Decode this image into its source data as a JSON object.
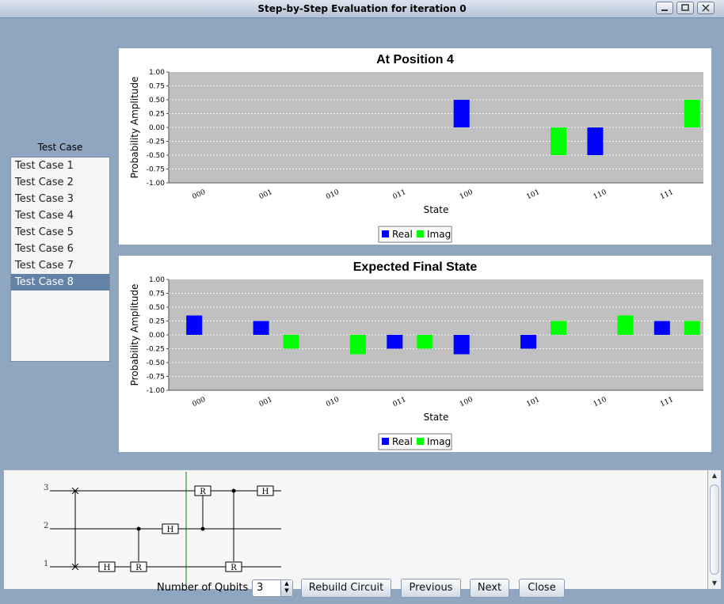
{
  "window": {
    "title": "Step-by-Step Evaluation for iteration 0"
  },
  "test_cases": {
    "label": "Test Case",
    "items": [
      "Test Case 1",
      "Test Case 2",
      "Test Case 3",
      "Test Case 4",
      "Test Case 5",
      "Test Case 6",
      "Test Case 7",
      "Test Case 8"
    ],
    "selected_index": 7
  },
  "chart_data": [
    {
      "type": "bar",
      "title": "At Position 4",
      "xlabel": "State",
      "ylabel": "Probability Amplitude",
      "categories": [
        "000",
        "001",
        "010",
        "011",
        "100",
        "101",
        "110",
        "111"
      ],
      "ylim": [
        -1.0,
        1.0
      ],
      "yticks": [
        "1.00",
        "0.75",
        "0.50",
        "0.25",
        "0.00",
        "-0.25",
        "-0.50",
        "-0.75",
        "-1.00"
      ],
      "series": [
        {
          "name": "Real",
          "color": "#0000ff",
          "values": [
            0,
            0,
            0,
            0,
            0.5,
            0,
            -0.5,
            0
          ]
        },
        {
          "name": "Imag",
          "color": "#00ff00",
          "values": [
            0,
            0,
            0,
            0,
            0,
            -0.5,
            0,
            0.5
          ]
        }
      ],
      "legend": "bottom-center",
      "grid": true
    },
    {
      "type": "bar",
      "title": "Expected Final State",
      "xlabel": "State",
      "ylabel": "Probability Amplitude",
      "categories": [
        "000",
        "001",
        "010",
        "011",
        "100",
        "101",
        "110",
        "111"
      ],
      "ylim": [
        -1.0,
        1.0
      ],
      "yticks": [
        "1.00",
        "0.75",
        "0.50",
        "0.25",
        "0.00",
        "-0.25",
        "-0.50",
        "-0.75",
        "-1.00"
      ],
      "series": [
        {
          "name": "Real",
          "color": "#0000ff",
          "values": [
            0.35,
            0.25,
            0,
            -0.25,
            -0.35,
            -0.25,
            0,
            0.25
          ]
        },
        {
          "name": "Imag",
          "color": "#00ff00",
          "values": [
            0,
            -0.25,
            -0.35,
            -0.25,
            0,
            0.25,
            0.35,
            0.25
          ]
        }
      ],
      "legend": "bottom-center",
      "grid": true
    }
  ],
  "circuit": {
    "wire_labels": [
      "3",
      "2",
      "1"
    ],
    "gates": [
      "H",
      "R",
      "H",
      "R",
      "R",
      "H"
    ]
  },
  "bottom": {
    "qubits_label": "Number of Qubits",
    "qubits_value": "3",
    "rebuild_label": "Rebuild Circuit",
    "previous_label": "Previous",
    "next_label": "Next",
    "close_label": "Close"
  }
}
